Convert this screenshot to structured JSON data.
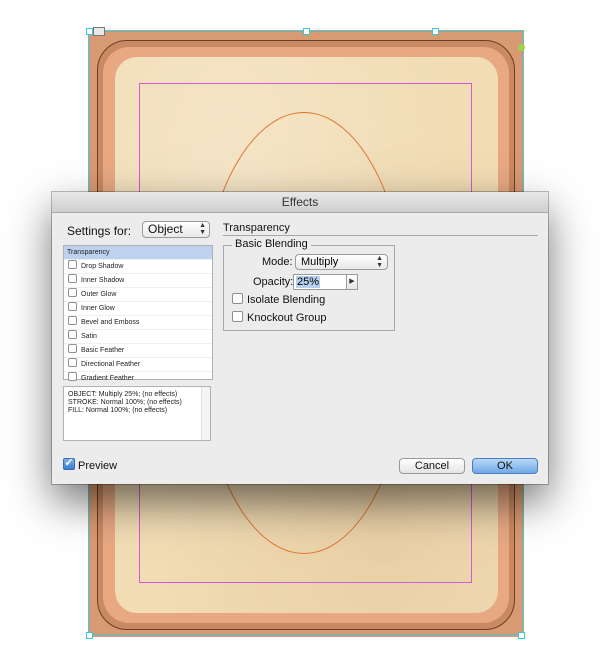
{
  "dialog": {
    "title": "Effects",
    "settings_for": {
      "label": "Settings for:",
      "value": "Object"
    },
    "effects": [
      {
        "label": "Transparency",
        "selected": true,
        "has_checkbox": false
      },
      {
        "label": "Drop Shadow",
        "selected": false,
        "has_checkbox": true,
        "checked": false
      },
      {
        "label": "Inner Shadow",
        "selected": false,
        "has_checkbox": true,
        "checked": false
      },
      {
        "label": "Outer Glow",
        "selected": false,
        "has_checkbox": true,
        "checked": false
      },
      {
        "label": "Inner Glow",
        "selected": false,
        "has_checkbox": true,
        "checked": false
      },
      {
        "label": "Bevel and Emboss",
        "selected": false,
        "has_checkbox": true,
        "checked": false
      },
      {
        "label": "Satin",
        "selected": false,
        "has_checkbox": true,
        "checked": false
      },
      {
        "label": "Basic Feather",
        "selected": false,
        "has_checkbox": true,
        "checked": false
      },
      {
        "label": "Directional Feather",
        "selected": false,
        "has_checkbox": true,
        "checked": false
      },
      {
        "label": "Gradient Feather",
        "selected": false,
        "has_checkbox": true,
        "checked": false
      }
    ],
    "summary": {
      "lines": [
        "OBJECT: Multiply 25%; (no effects)",
        "STROKE: Normal 100%; (no effects)",
        "FILL: Normal 100%; (no effects)"
      ]
    },
    "preview": {
      "label": "Preview",
      "checked": true
    },
    "section_title": "Transparency",
    "basic_blending": {
      "legend": "Basic Blending",
      "mode_label": "Mode:",
      "mode_value": "Multiply",
      "opacity_label": "Opacity:",
      "opacity_value": "25%"
    },
    "isolate_blending": {
      "label": "Isolate Blending",
      "checked": false
    },
    "knockout_group": {
      "label": "Knockout Group",
      "checked": false
    },
    "buttons": {
      "cancel": "Cancel",
      "ok": "OK"
    }
  },
  "colors": {
    "selection_cyan": "#3ac7d8",
    "guide_magenta": "#d35ad6",
    "oval_orange": "#e0742c",
    "list_selection": "#bcd2ef",
    "ok_button": "#6fa8e6"
  }
}
